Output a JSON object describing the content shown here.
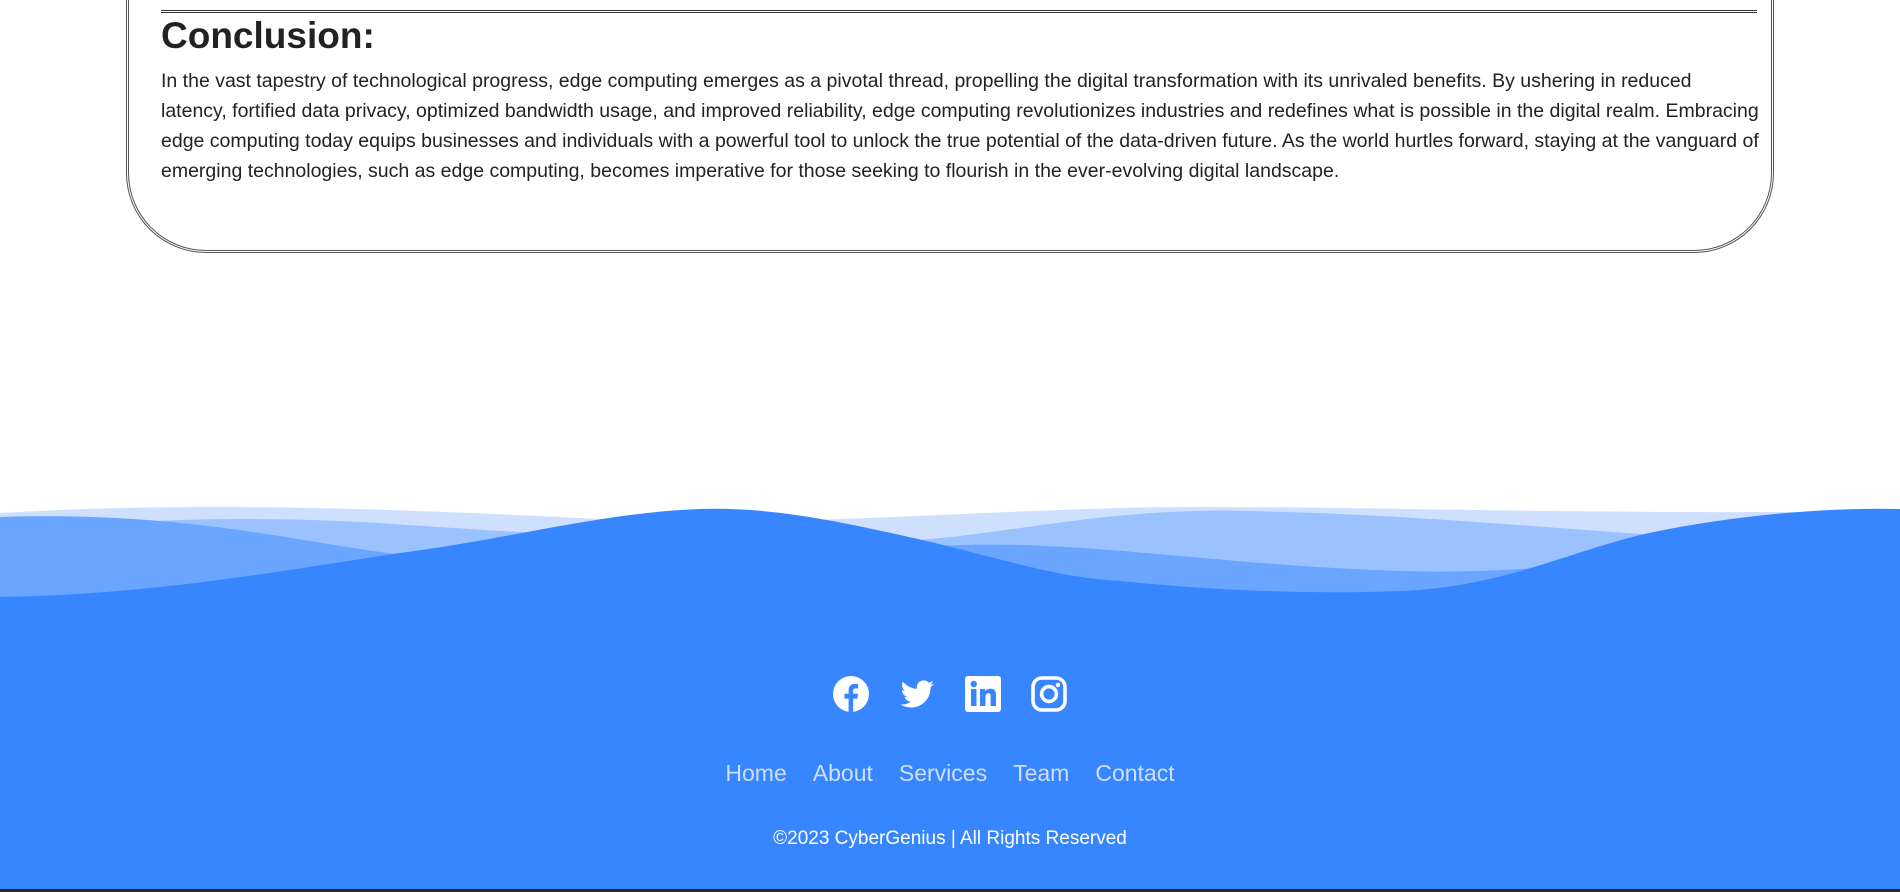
{
  "conclusion": {
    "heading": "Conclusion:",
    "body": "In the vast tapestry of technological progress, edge computing emerges as a pivotal thread, propelling the digital transformation with its unrivaled benefits. By ushering in reduced latency, fortified data privacy, optimized bandwidth usage, and improved reliability, edge computing revolutionizes industries and redefines what is possible in the digital realm. Embracing edge computing today equips businesses and individuals with a powerful tool to unlock the true potential of the data-driven future. As the world hurtles forward, staying at the vanguard of emerging technologies, such as edge computing, becomes imperative for those seeking to flourish in the ever-evolving digital landscape."
  },
  "footer": {
    "colors": {
      "primary": "#3886ff",
      "wave_mid": "#6aa5ff",
      "wave_light": "#9ac2ff",
      "wave_lightest": "#cfe0ff"
    },
    "social": [
      {
        "icon": "facebook-icon"
      },
      {
        "icon": "twitter-icon"
      },
      {
        "icon": "linkedin-icon"
      },
      {
        "icon": "instagram-icon"
      }
    ],
    "menu": [
      "Home",
      "About",
      "Services",
      "Team",
      "Contact"
    ],
    "copyright": "©2023 CyberGenius | All Rights Reserved"
  }
}
